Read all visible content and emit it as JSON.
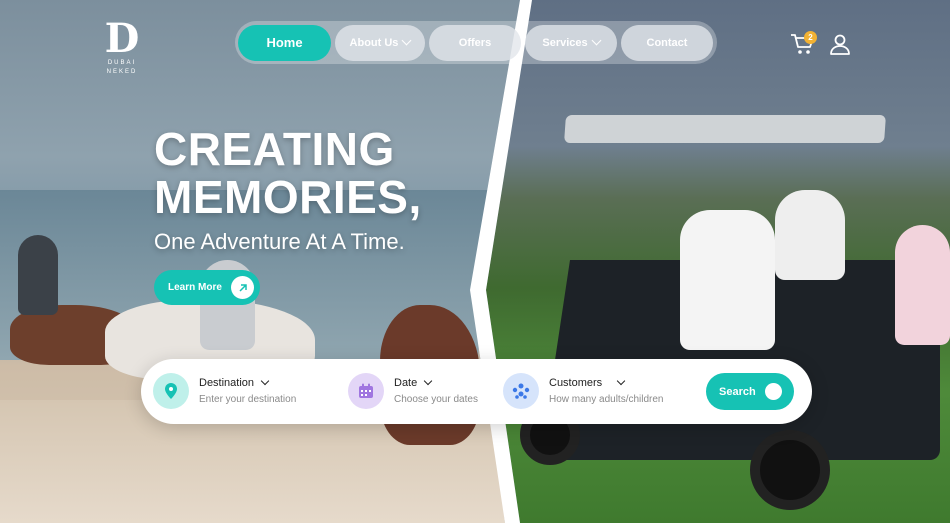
{
  "brand": {
    "logo_mark": "D",
    "logo_text_top": "DUBAI",
    "logo_text_bottom": "NEKED"
  },
  "nav": {
    "items": [
      {
        "label": "Home",
        "active": true
      },
      {
        "label": "About Us",
        "dropdown": true
      },
      {
        "label": "Offers"
      },
      {
        "label": "Services",
        "dropdown": true
      },
      {
        "label": "Contact"
      }
    ]
  },
  "header_actions": {
    "cart_icon": "cart-icon",
    "cart_count": "2",
    "user_icon": "user-icon"
  },
  "hero": {
    "title_line1": "CREATING",
    "title_line2": "MEMORIES,",
    "subtitle": "One Adventure At A Time.",
    "cta_label": "Learn More"
  },
  "search": {
    "destination": {
      "label": "Destination",
      "placeholder": "Enter your destination",
      "icon": "location-pin-icon"
    },
    "date": {
      "label": "Date",
      "placeholder": "Choose your dates",
      "icon": "calendar-icon"
    },
    "customers": {
      "label": "Customers",
      "placeholder": "How many adults/children",
      "icon": "people-icon"
    },
    "button_label": "Search"
  },
  "colors": {
    "accent": "#16c2b4",
    "badge": "#f3b233"
  }
}
